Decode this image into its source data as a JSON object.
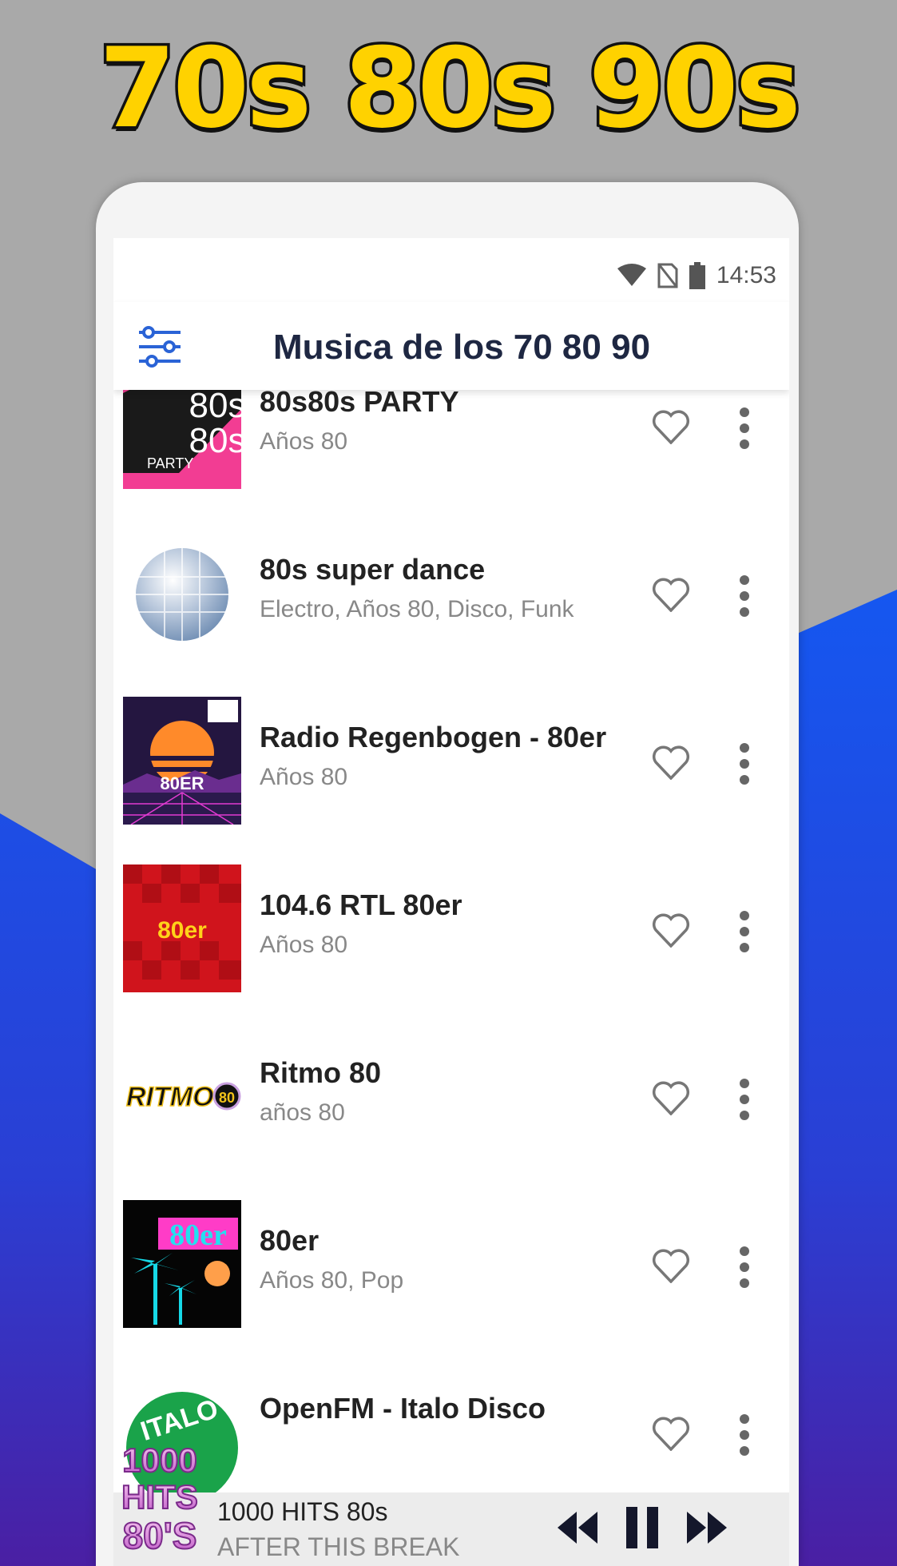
{
  "promo": {
    "headline": "70s 80s 90s"
  },
  "status_bar": {
    "time": "14:53",
    "icons": [
      "wifi-icon",
      "no-sim-icon",
      "battery-icon"
    ]
  },
  "app_bar": {
    "title": "Musica de los 70 80 90",
    "menu_icon": "tune-sliders-icon"
  },
  "stations": [
    {
      "title": "80s80s PARTY",
      "genres": "Años 80",
      "logo_text": "80s 80s PARTY"
    },
    {
      "title": "80s super dance",
      "genres": "Electro, Años 80, Disco, Funk",
      "logo_text": ""
    },
    {
      "title": "Radio Regenbogen - 80er",
      "genres": "Años 80",
      "logo_text": "80ER"
    },
    {
      "title": "104.6 RTL 80er",
      "genres": "Años 80",
      "logo_text": "80er"
    },
    {
      "title": "Ritmo 80",
      "genres": "años 80",
      "logo_text": "RITMO80"
    },
    {
      "title": "80er",
      "genres": "Años 80, Pop",
      "logo_text": "80er"
    },
    {
      "title": "OpenFM - Italo Disco",
      "genres": "",
      "logo_text": "ITALO"
    }
  ],
  "player": {
    "station": "1000 HITS 80s",
    "track": "AFTER THIS BREAK",
    "logo_text": "1000 HITS 80'S"
  },
  "colors": {
    "brand_blue": "#1e4fe8",
    "title_yellow": "#ffd200",
    "appbar_title": "#1e2742",
    "icon_blue": "#2a63d6"
  }
}
